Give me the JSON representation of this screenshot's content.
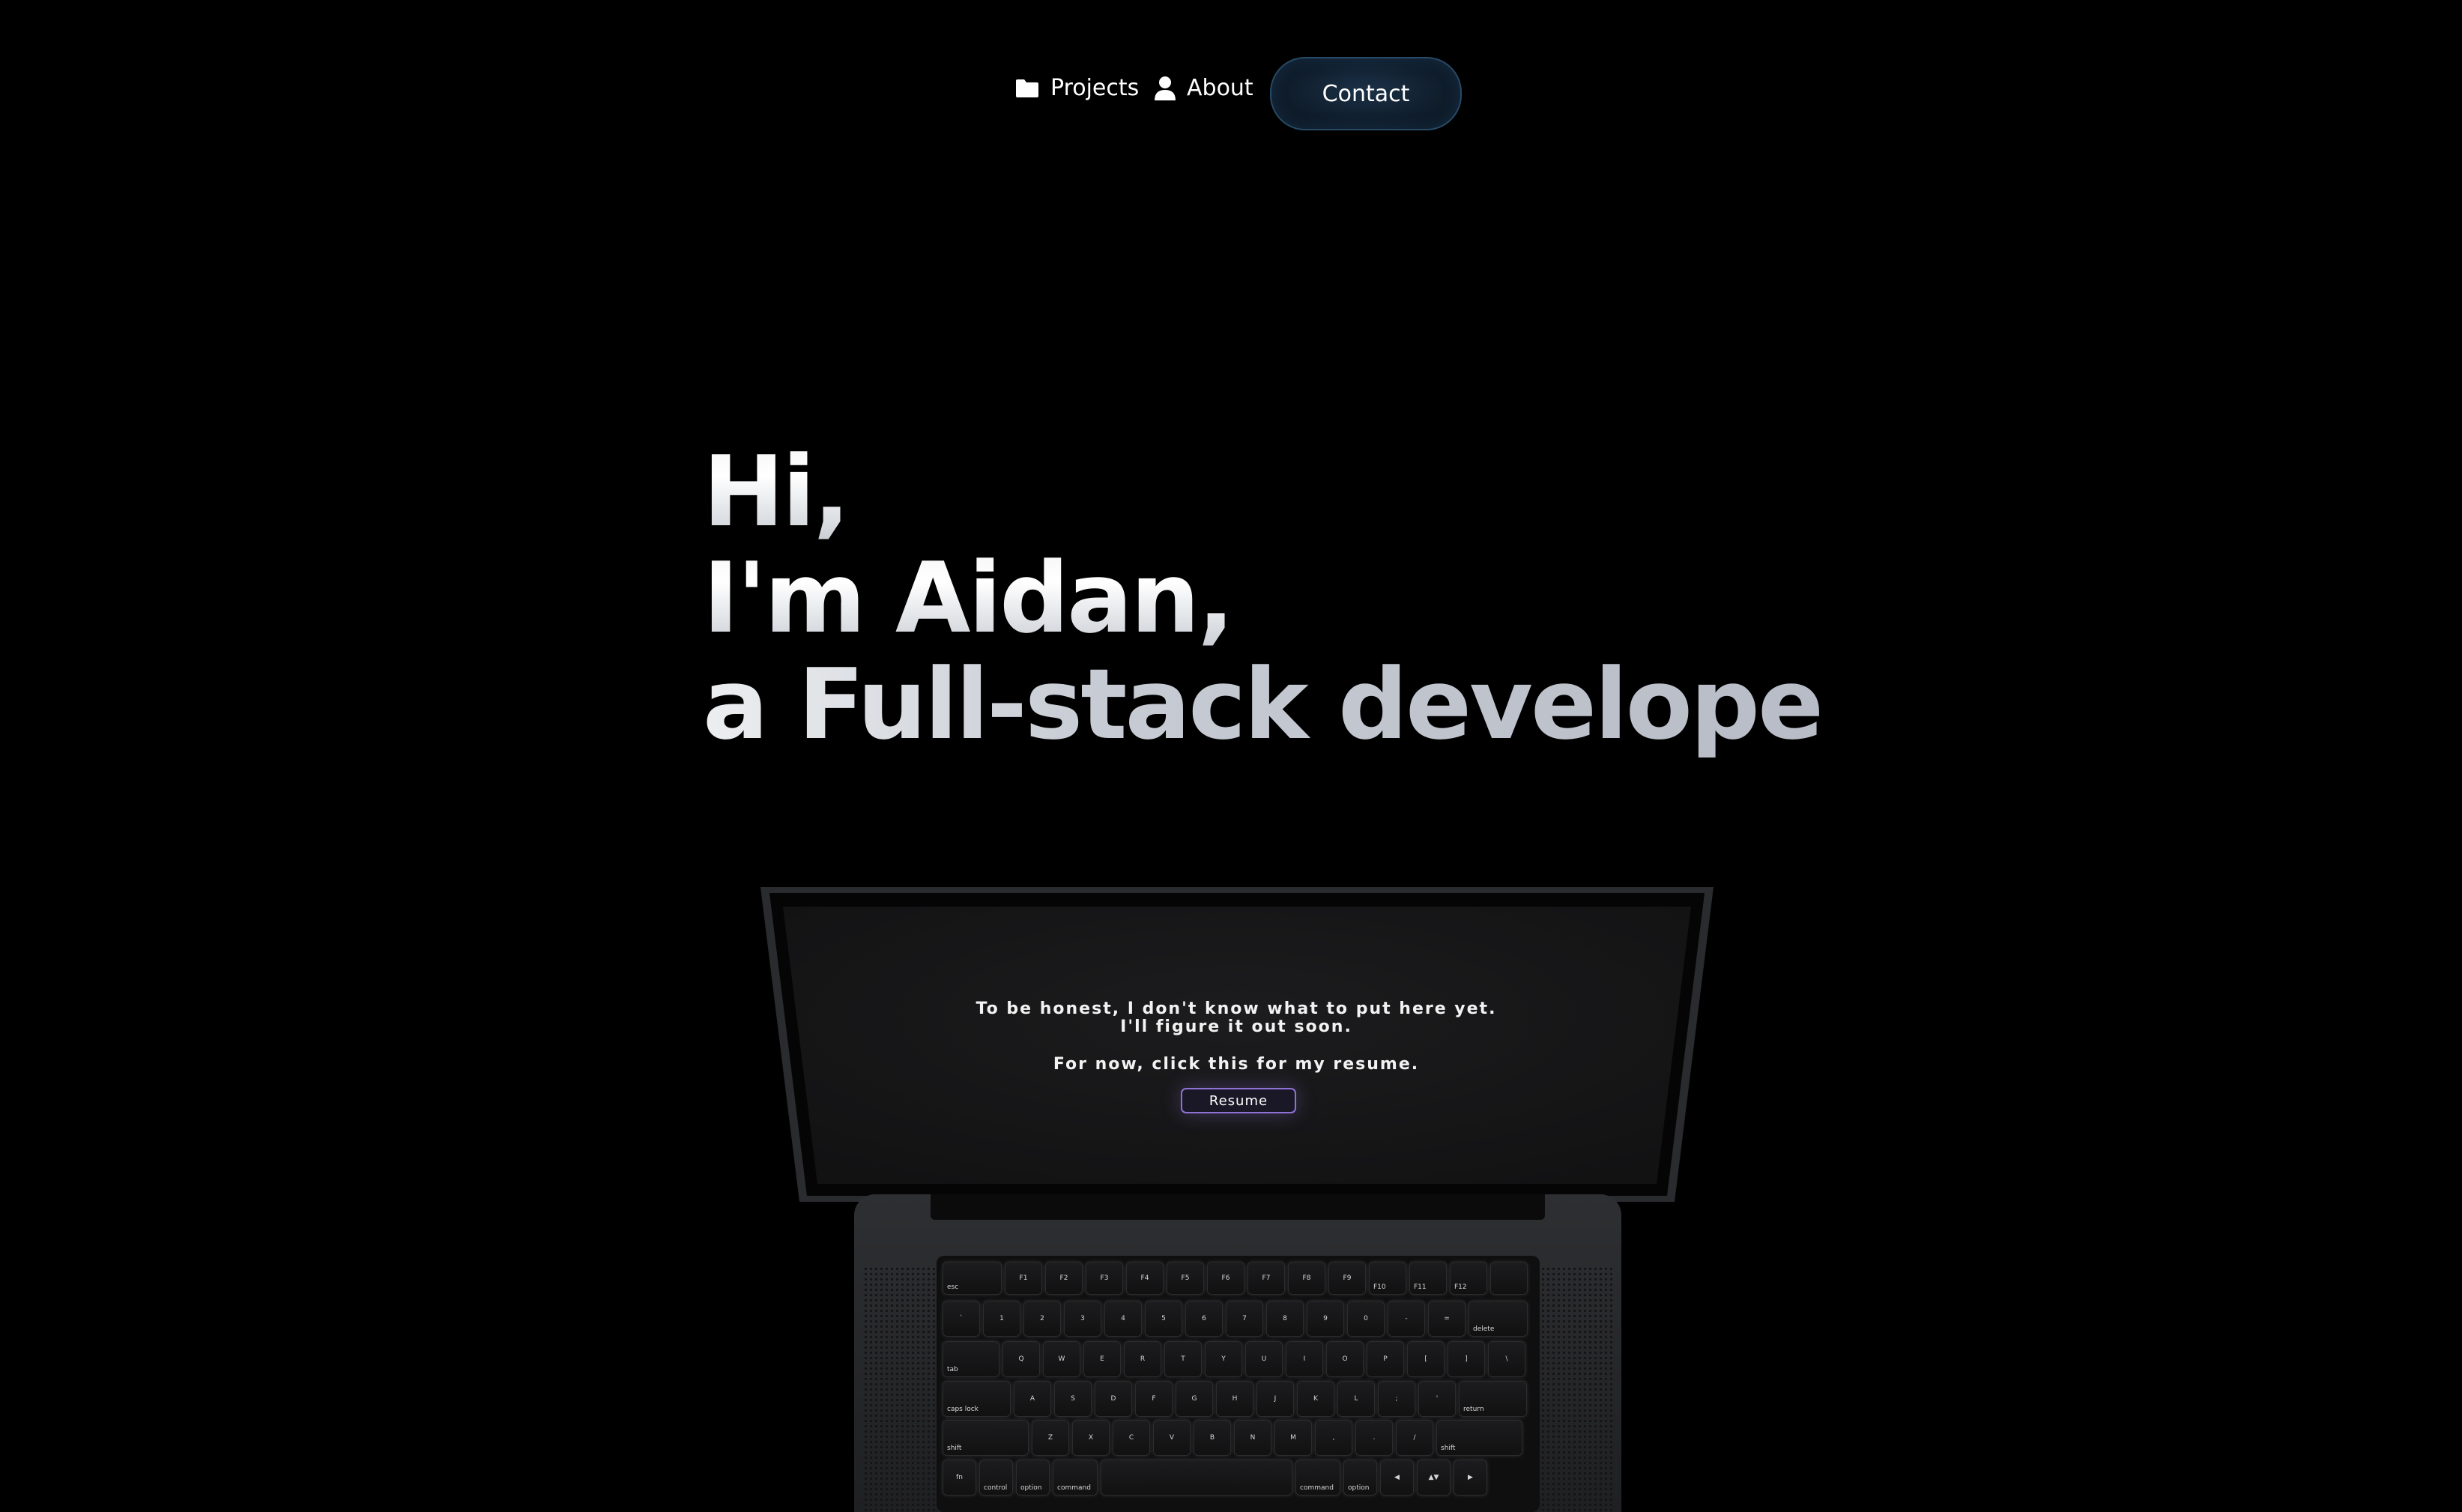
{
  "nav": {
    "projects_label": "Projects",
    "about_label": "About",
    "contact_label": "Contact",
    "icons": {
      "projects": "folder-icon",
      "about": "user-icon"
    }
  },
  "hero": {
    "line1": "Hi,",
    "line2": "I'm Aidan,",
    "line3": "a Full-stack developer."
  },
  "laptop_screen": {
    "line1": "To be honest, I don't know what to put here yet.",
    "line2": "I'll figure it out soon.",
    "line3": "For now, click this for my resume.",
    "resume_button": "Resume"
  },
  "keyboard": {
    "rows": [
      [
        "esc",
        "F1",
        "F2",
        "F3",
        "F4",
        "F5",
        "F6",
        "F7",
        "F8",
        "F9",
        "F10",
        "F11",
        "F12",
        ""
      ],
      [
        "`",
        "1",
        "2",
        "3",
        "4",
        "5",
        "6",
        "7",
        "8",
        "9",
        "0",
        "-",
        "=",
        "delete"
      ],
      [
        "tab",
        "Q",
        "W",
        "E",
        "R",
        "T",
        "Y",
        "U",
        "I",
        "O",
        "P",
        "[",
        "]",
        "\\"
      ],
      [
        "caps lock",
        "A",
        "S",
        "D",
        "F",
        "G",
        "H",
        "J",
        "K",
        "L",
        ";",
        "'",
        "return"
      ],
      [
        "shift",
        "Z",
        "X",
        "C",
        "V",
        "B",
        "N",
        "M",
        ",",
        ".",
        "/",
        "shift"
      ],
      [
        "fn",
        "control",
        "option",
        "command",
        "",
        "command",
        "option",
        "◀",
        "▲▼",
        "▶"
      ]
    ]
  },
  "colors": {
    "background": "#000000",
    "contact_bg": "#101e2d",
    "contact_border": "#274a66",
    "resume_border": "#8e72d6"
  }
}
